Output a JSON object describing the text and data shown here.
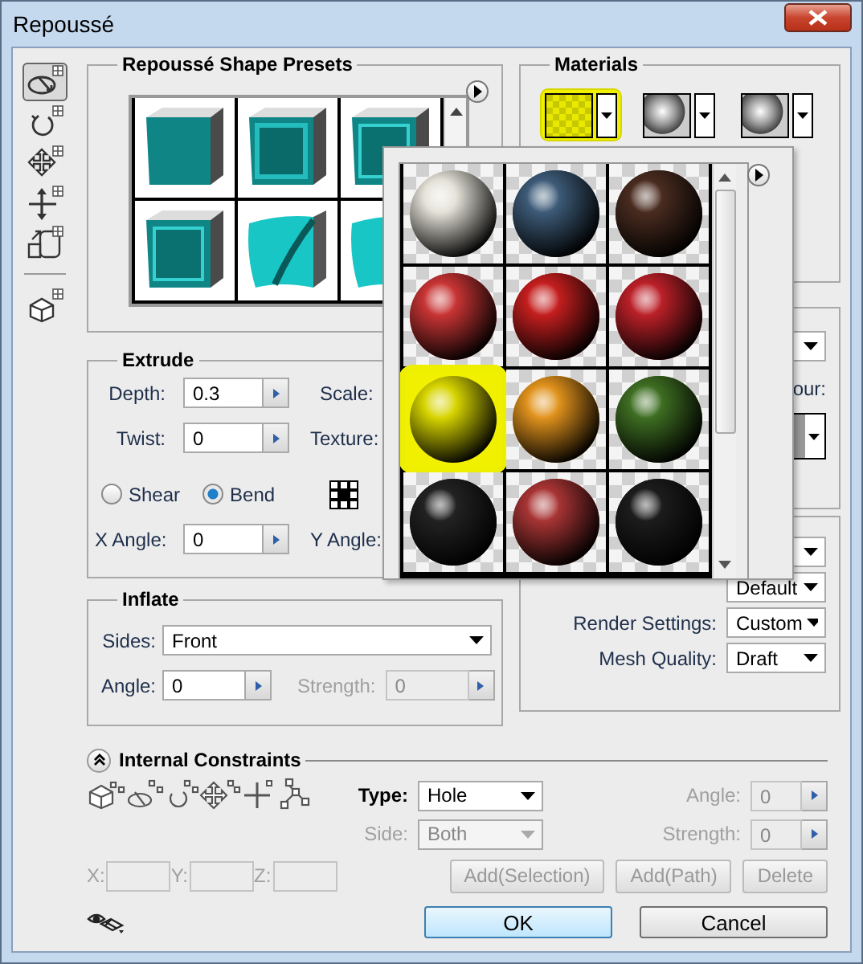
{
  "window": {
    "title": "Repoussé"
  },
  "tools": [
    {
      "kind": "orbit",
      "selected": true
    },
    {
      "kind": "roll",
      "selected": false
    },
    {
      "kind": "drag",
      "selected": false
    },
    {
      "kind": "slide",
      "selected": false
    },
    {
      "kind": "scale",
      "selected": false
    },
    {
      "kind": "camera",
      "selected": false
    }
  ],
  "presets": {
    "title": "Repoussé Shape Presets",
    "items": [
      {
        "kind": "plain"
      },
      {
        "kind": "bevel"
      },
      {
        "kind": "frame"
      },
      {
        "kind": "frame"
      },
      {
        "kind": "twist"
      },
      {
        "kind": "inflate"
      }
    ]
  },
  "materials": {
    "title": "Materials",
    "swatches": [
      {
        "kind": "checker",
        "selected": true
      },
      {
        "kind": "sphere",
        "selected": false
      },
      {
        "kind": "sphere",
        "selected": false
      }
    ]
  },
  "material_picker": {
    "items": [
      {
        "color": "#e4e2d8",
        "selected": false
      },
      {
        "color": "#3d5b78",
        "selected": false
      },
      {
        "color": "#4a2c20",
        "selected": false
      },
      {
        "color": "#c83434",
        "selected": false
      },
      {
        "color": "#c41e1e",
        "selected": false
      },
      {
        "color": "#bb2028",
        "selected": false
      },
      {
        "color": "#d6d400",
        "selected": true
      },
      {
        "color": "#e0921c",
        "selected": false
      },
      {
        "color": "#3e6e22",
        "selected": false
      },
      {
        "color": "#222222",
        "selected": false
      },
      {
        "color": "#a83434",
        "selected": false
      },
      {
        "color": "#1c1c1c",
        "selected": false
      }
    ]
  },
  "extrude": {
    "title": "Extrude",
    "depth": {
      "label": "Depth:",
      "value": "0.3"
    },
    "scale_label": "Scale:",
    "twist": {
      "label": "Twist:",
      "value": "0"
    },
    "texture_label": "Texture:",
    "bend_options": [
      {
        "label": "Shear",
        "selected": false
      },
      {
        "label": "Bend",
        "selected": true
      }
    ],
    "x_angle": {
      "label": "X Angle:",
      "value": "0"
    },
    "y_angle_label": "Y Angle:"
  },
  "scene": {
    "colour_label": "our:"
  },
  "render": {
    "view_value": "Default",
    "render_settings": {
      "label": "Render Settings:",
      "value": "Custom"
    },
    "mesh_quality": {
      "label": "Mesh Quality:",
      "value": "Draft"
    }
  },
  "inflate": {
    "title": "Inflate",
    "sides": {
      "label": "Sides:",
      "value": "Front"
    },
    "angle": {
      "label": "Angle:",
      "value": "0"
    },
    "strength": {
      "label": "Strength:",
      "value": "0",
      "disabled": true
    }
  },
  "constraints": {
    "title": "Internal Constraints",
    "expanded": true,
    "type": {
      "label": "Type:",
      "value": "Hole"
    },
    "side": {
      "label": "Side:",
      "value": "Both",
      "disabled": true
    },
    "angle": {
      "label": "Angle:",
      "value": "0",
      "disabled": true
    },
    "strength": {
      "label": "Strength:",
      "value": "0",
      "disabled": true
    },
    "coords": [
      {
        "label": "X:",
        "disabled": true
      },
      {
        "label": "Y:",
        "disabled": true
      },
      {
        "label": "Z:",
        "disabled": true
      }
    ],
    "buttons": [
      {
        "label": "Add(Selection)",
        "disabled": true
      },
      {
        "label": "Add(Path)",
        "disabled": true
      },
      {
        "label": "Delete",
        "disabled": true
      }
    ]
  },
  "buttons": [
    {
      "label": "OK",
      "kind": "default"
    },
    {
      "label": "Cancel",
      "kind": "normal"
    }
  ]
}
